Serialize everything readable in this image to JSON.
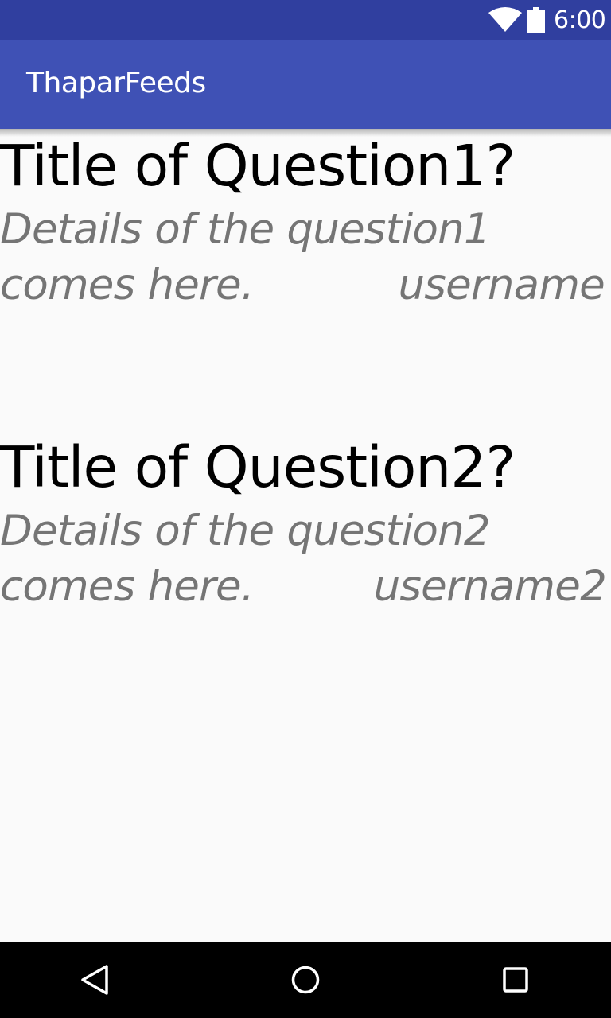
{
  "status_bar": {
    "time": "6:00",
    "wifi_icon": "wifi-icon",
    "battery_icon": "battery-icon",
    "background": "#303f9f"
  },
  "app_bar": {
    "title": "ThaparFeeds",
    "background": "#3f51b5"
  },
  "feed": {
    "questions": [
      {
        "title": "Title of Question1?",
        "details": "Details of the question1 comes here.",
        "username": "username"
      },
      {
        "title": "Title of Question2?",
        "details": "Details of the question2 comes here.",
        "username": "username2"
      }
    ]
  },
  "nav_bar": {
    "back_icon": "back-triangle-icon",
    "home_icon": "home-circle-icon",
    "recents_icon": "recents-square-icon"
  }
}
